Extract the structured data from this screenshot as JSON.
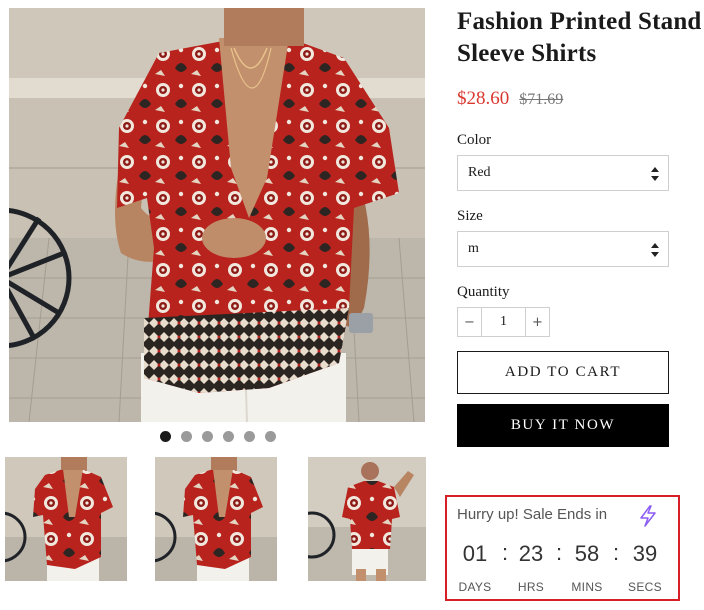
{
  "product": {
    "title_line1": "Fashion Printed Stand",
    "title_line2": "Sleeve Shirts",
    "price": "$28.60",
    "compare_price": "$71.69"
  },
  "options": {
    "color_label": "Color",
    "color_value": "Red",
    "size_label": "Size",
    "size_value": "m",
    "quantity_label": "Quantity",
    "quantity_value": "1",
    "minus": "−",
    "plus": "+"
  },
  "buttons": {
    "add_to_cart": "ADD TO CART",
    "buy_now": "BUY IT NOW"
  },
  "gallery": {
    "slide_count": 6,
    "active_slide": 1,
    "thumbnails": [
      "shirt-front-photo",
      "shirt-front-photo",
      "shirt-full-body-photo"
    ]
  },
  "countdown": {
    "heading": "Hurry up! Sale Ends in",
    "days": "01",
    "hours": "23",
    "minutes": "58",
    "seconds": "39",
    "days_label": "DAYS",
    "hours_label": "HRS",
    "minutes_label": "MINS",
    "seconds_label": "SECS",
    "icon": "lightning-bolt-icon",
    "border_color": "#d61f26"
  },
  "colors": {
    "sale_price": "#d9382f",
    "buy_button": "#000000",
    "accent_icon": "#8b5cf6"
  }
}
